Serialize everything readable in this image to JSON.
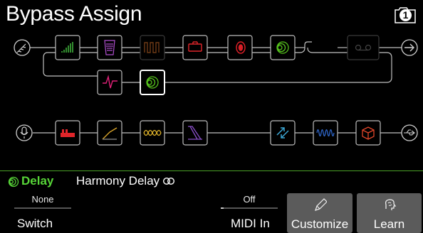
{
  "header": {
    "title": "Bypass Assign",
    "snapshot_number": "1"
  },
  "path1": {
    "input_icon": "guitar-input-icon",
    "output_icon": "arrow-output-icon",
    "blocks": [
      {
        "name": "eq-block",
        "icon": "graphic-eq-icon",
        "color": "#3fae3a"
      },
      {
        "name": "wah-block",
        "icon": "wah-pedal-icon",
        "color": "#b04fcf"
      },
      {
        "name": "dynamics-block-bypassed",
        "icon": "gate-icon",
        "color": "#6e3a16"
      },
      {
        "name": "amp-block",
        "icon": "amp-icon",
        "color": "#e0252a"
      },
      {
        "name": "cab-block",
        "icon": "speaker-icon",
        "color": "#d81f26"
      },
      {
        "name": "delay-block",
        "icon": "delay-rings-icon",
        "color": "#56c21d"
      },
      {
        "name": "looper-block-bypassed",
        "icon": "looper-icon",
        "color": "#444444"
      },
      {
        "name": "filter-block",
        "icon": "pulse-filter-icon",
        "color": "#e02178"
      },
      {
        "name": "delay-block-selected",
        "icon": "delay-rings-icon",
        "color": "#56c21d"
      }
    ]
  },
  "path2": {
    "input_icon": "mic-input-icon",
    "output_icon": "usb-output-icon",
    "blocks": [
      {
        "name": "distortion-block",
        "icon": "distortion-pedal-icon",
        "color": "#e0252a"
      },
      {
        "name": "compressor-block",
        "icon": "compressor-icon",
        "color": "#dba52a"
      },
      {
        "name": "modulation-block",
        "icon": "modulation-icon",
        "color": "#e1b42a"
      },
      {
        "name": "eq-filter-block",
        "icon": "filter-slope-icon",
        "color": "#8a4fc9"
      },
      {
        "name": "pitch-block",
        "icon": "pitch-arrows-icon",
        "color": "#3ba7d5"
      },
      {
        "name": "reverb-block",
        "icon": "reverb-wave-icon",
        "color": "#2f66c8"
      },
      {
        "name": "fx-loop-block",
        "icon": "cube-icon",
        "color": "#e2462a"
      }
    ]
  },
  "info": {
    "category": "Delay",
    "model": "Harmony Delay",
    "category_color": "#57d538",
    "stereo_icon": "stereo-link-icon"
  },
  "controls": {
    "switch": {
      "value": "None",
      "label": "Switch",
      "level": 0
    },
    "midi": {
      "value": "Off",
      "label": "MIDI In",
      "level": 0.05
    },
    "customize": {
      "label": "Customize",
      "icon": "pencil-icon"
    },
    "learn": {
      "label": "Learn",
      "icon": "brain-icon"
    }
  }
}
